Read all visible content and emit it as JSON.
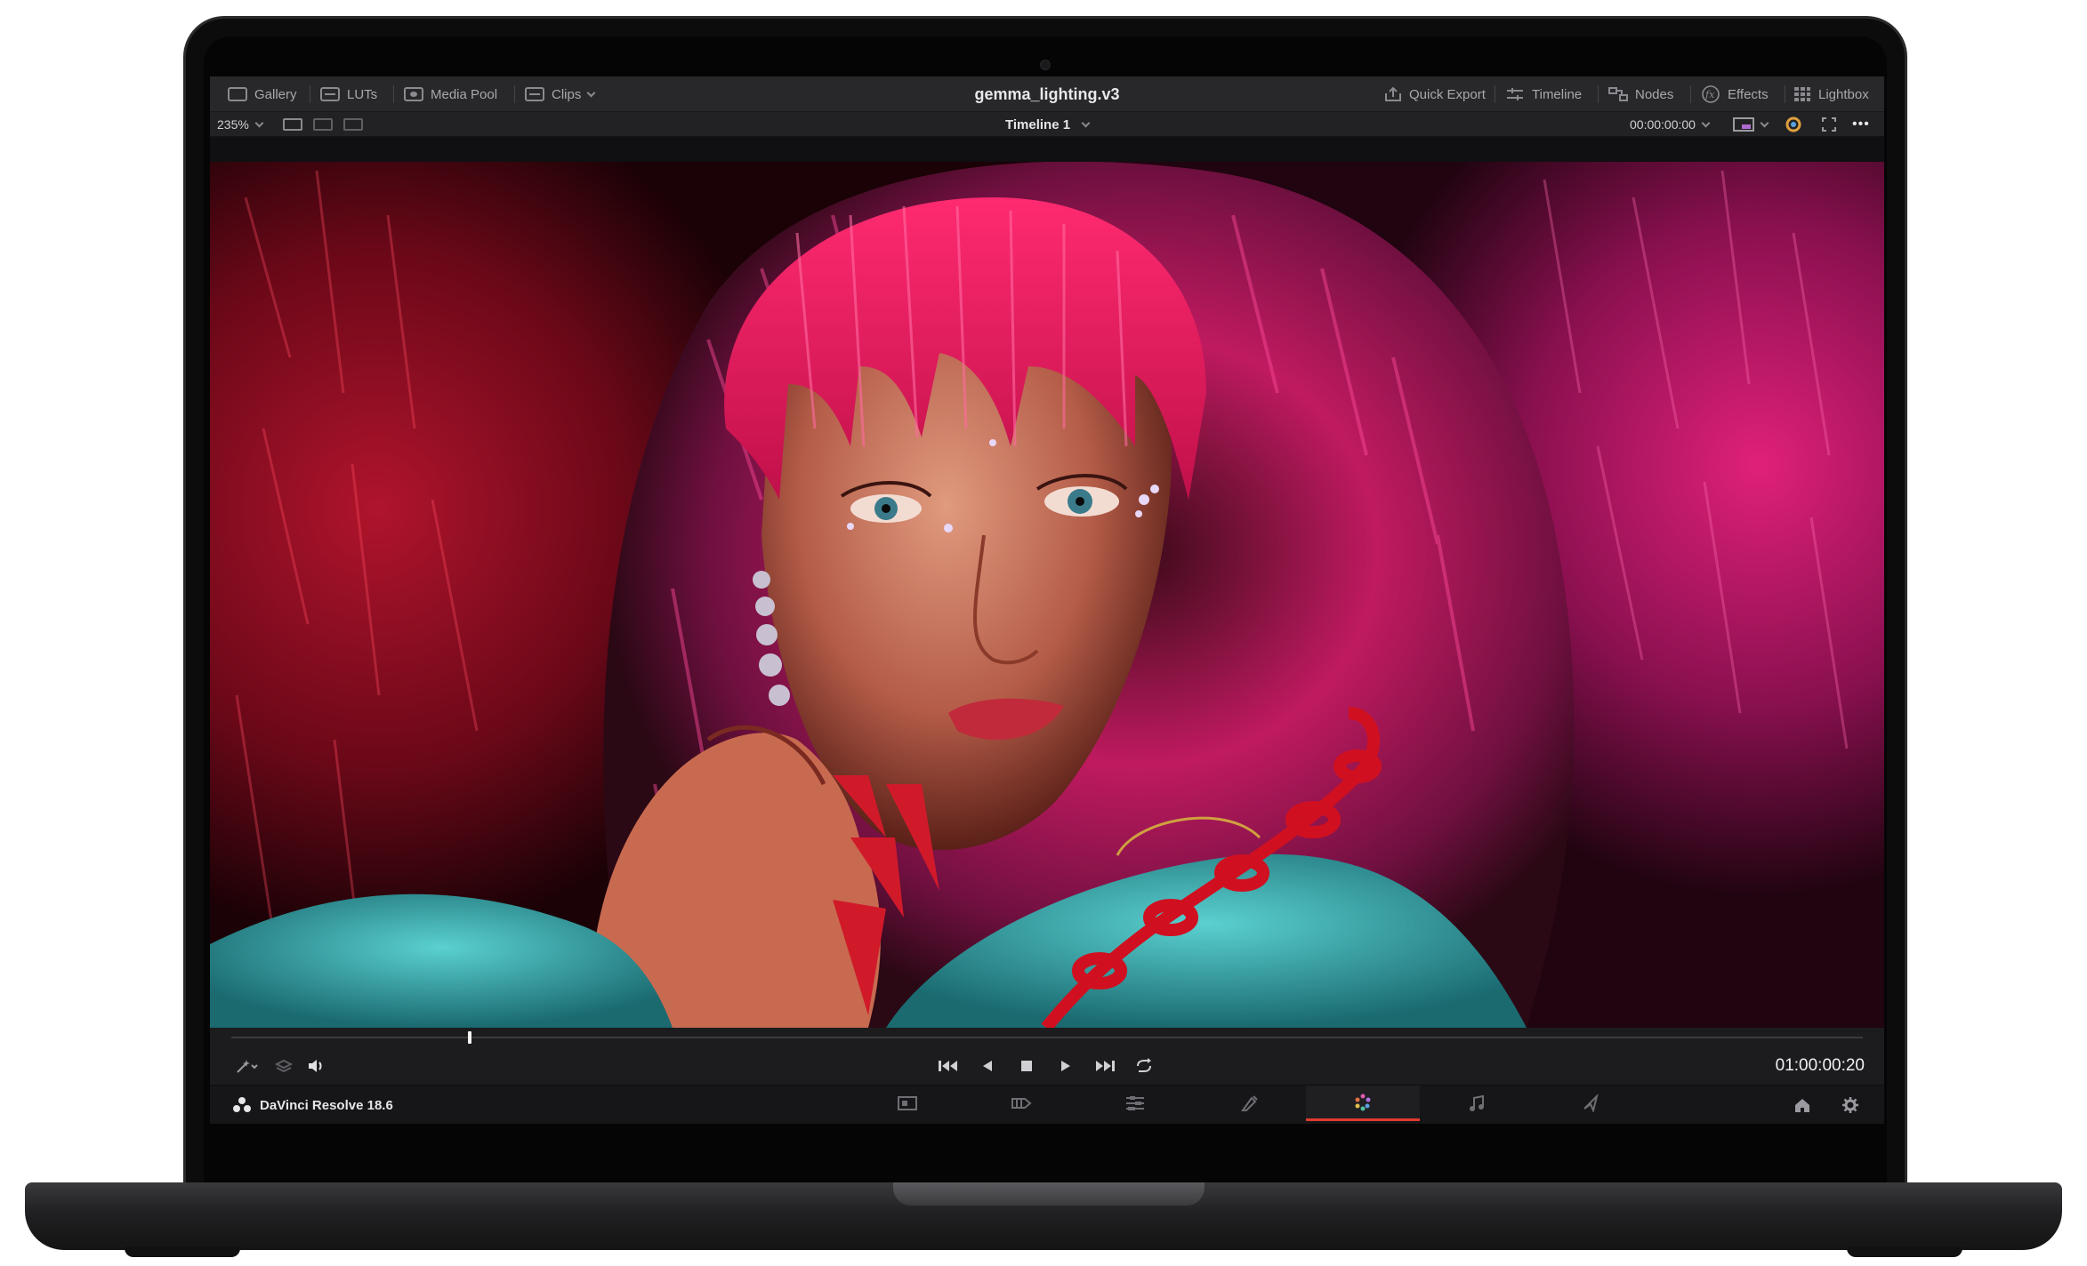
{
  "topbar": {
    "left_items": [
      {
        "label": "Gallery",
        "icon": "gallery-icon"
      },
      {
        "label": "LUTs",
        "icon": "luts-icon"
      },
      {
        "label": "Media Pool",
        "icon": "media-pool-icon"
      },
      {
        "label": "Clips",
        "icon": "clips-icon"
      }
    ],
    "title": "gemma_lighting.v3",
    "right_items": [
      {
        "label": "Quick Export",
        "icon": "quick-export-icon"
      },
      {
        "label": "Timeline",
        "icon": "timeline-icon"
      },
      {
        "label": "Nodes",
        "icon": "nodes-icon"
      },
      {
        "label": "Effects",
        "icon": "effects-icon"
      },
      {
        "label": "Lightbox",
        "icon": "lightbox-icon"
      }
    ]
  },
  "subbar": {
    "zoom": "235%",
    "timeline_name": "Timeline 1",
    "source_timecode": "00:00:00:00",
    "more_glyph": "•••"
  },
  "viewer": {
    "image": "portrait-with-magenta-fur-hood"
  },
  "scrubber": {
    "playhead_fraction": 0.145
  },
  "transport": {
    "timecode": "01:00:00:20",
    "icons": [
      "go-to-start-icon",
      "play-reverse-icon",
      "stop-icon",
      "play-icon",
      "go-to-end-icon",
      "loop-icon"
    ]
  },
  "pagebar": {
    "brand": "DaVinci Resolve 18.6",
    "pages": [
      {
        "name": "media",
        "icon": "media-page-icon",
        "active": false
      },
      {
        "name": "cut",
        "icon": "cut-page-icon",
        "active": false
      },
      {
        "name": "edit",
        "icon": "edit-page-icon",
        "active": false
      },
      {
        "name": "fusion",
        "icon": "fusion-page-icon",
        "active": false
      },
      {
        "name": "color",
        "icon": "color-page-icon",
        "active": true
      },
      {
        "name": "fairlight",
        "icon": "fairlight-page-icon",
        "active": false
      },
      {
        "name": "deliver",
        "icon": "deliver-page-icon",
        "active": false
      }
    ]
  },
  "colors": {
    "accent_active_page": "#e03a2e",
    "color_page_icon": "#d46ab8"
  }
}
